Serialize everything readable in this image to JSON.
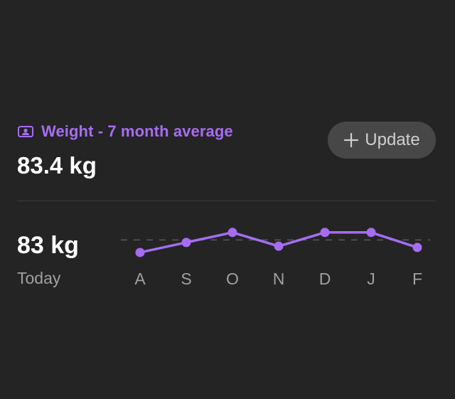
{
  "header": {
    "title": "Weight - 7 month average",
    "icon": "person-badge-icon",
    "accent_color": "#a66cf2"
  },
  "average": {
    "value": "83.4 kg"
  },
  "update_button": {
    "label": "Update",
    "icon": "plus-icon"
  },
  "today": {
    "value": "83 kg",
    "label": "Today"
  },
  "chart_data": {
    "type": "line",
    "categories": [
      "A",
      "S",
      "O",
      "N",
      "D",
      "J",
      "F"
    ],
    "values": [
      82.4,
      83.2,
      84.0,
      82.9,
      84.0,
      84.0,
      82.8
    ],
    "reference_line": 83.4,
    "ylim": [
      82.0,
      84.5
    ],
    "color": "#a66cf2",
    "grid": false
  }
}
